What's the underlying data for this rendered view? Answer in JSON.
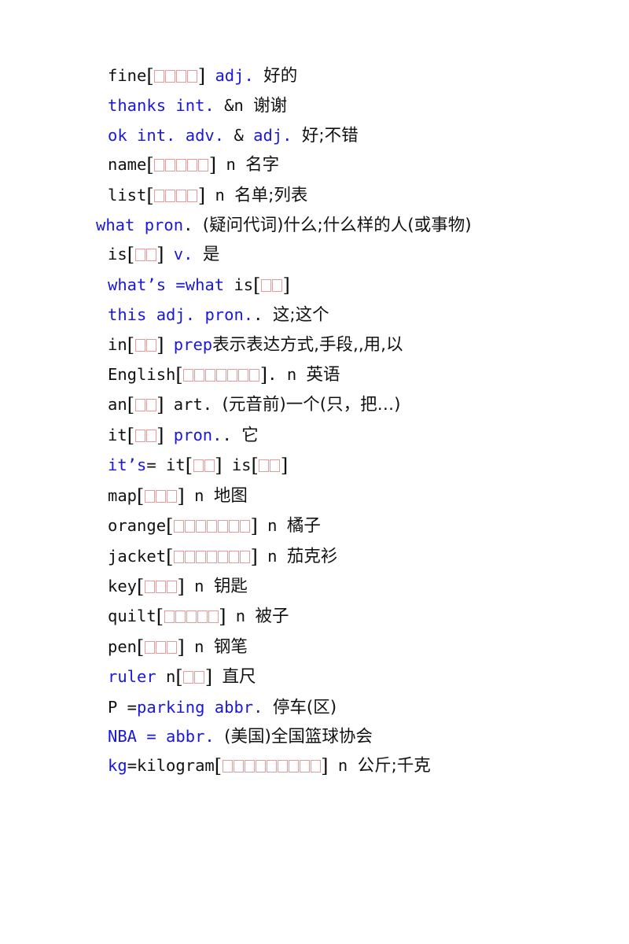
{
  "document": {
    "type": "vocabulary-word-list",
    "language_pair": "English-Chinese",
    "text_colors": {
      "accent_blue": "#1a18d8",
      "body_black": "#111111",
      "tofu_box_outline": "#e89a9a"
    },
    "note": "Phonetic transcriptions render as missing-glyph boxes (tofu)"
  },
  "entries": [
    {
      "id": "fine",
      "indent": "normal",
      "parts": [
        {
          "text": "fine",
          "color": "black",
          "script": "latin"
        },
        {
          "type": "phonetic",
          "boxes": 4
        },
        {
          "text": " ",
          "color": "black",
          "script": "latin"
        },
        {
          "text": "adj.",
          "color": "blue",
          "script": "latin"
        },
        {
          "text": " ",
          "color": "black",
          "script": "latin"
        },
        {
          "text": "好的",
          "color": "black",
          "script": "han"
        }
      ]
    },
    {
      "id": "thanks",
      "indent": "normal",
      "parts": [
        {
          "text": "thanks int.",
          "color": "blue",
          "script": "latin"
        },
        {
          "text": " &n ",
          "color": "black",
          "script": "latin"
        },
        {
          "text": "谢谢",
          "color": "black",
          "script": "han"
        }
      ]
    },
    {
      "id": "ok",
      "indent": "normal",
      "parts": [
        {
          "text": "ok int. adv.",
          "color": "blue",
          "script": "latin"
        },
        {
          "text": " & ",
          "color": "black",
          "script": "latin"
        },
        {
          "text": "adj.",
          "color": "blue",
          "script": "latin"
        },
        {
          "text": " ",
          "color": "black",
          "script": "latin"
        },
        {
          "text": "好;不错",
          "color": "black",
          "script": "han"
        }
      ]
    },
    {
      "id": "name",
      "indent": "normal",
      "parts": [
        {
          "text": "name",
          "color": "black",
          "script": "latin"
        },
        {
          "type": "phonetic",
          "boxes": 5
        },
        {
          "text": " n ",
          "color": "black",
          "script": "latin"
        },
        {
          "text": "名字",
          "color": "black",
          "script": "han"
        }
      ]
    },
    {
      "id": "list",
      "indent": "normal",
      "parts": [
        {
          "text": "list",
          "color": "black",
          "script": "latin"
        },
        {
          "type": "phonetic",
          "boxes": 4
        },
        {
          "text": " n ",
          "color": "black",
          "script": "latin"
        },
        {
          "text": "名单;列表",
          "color": "black",
          "script": "han"
        }
      ]
    },
    {
      "id": "what",
      "indent": "small",
      "parts": [
        {
          "text": "what pron",
          "color": "blue",
          "script": "latin"
        },
        {
          "text": ". ",
          "color": "black",
          "script": "latin"
        },
        {
          "text": "(疑问代词)什么;什么样的人(或事物)",
          "color": "black",
          "script": "han",
          "wrapable": true
        }
      ]
    },
    {
      "id": "is",
      "indent": "normal",
      "parts": [
        {
          "text": "is",
          "color": "black",
          "script": "latin"
        },
        {
          "type": "phonetic",
          "boxes": 2
        },
        {
          "text": " ",
          "color": "black",
          "script": "latin"
        },
        {
          "text": "v.",
          "color": "blue",
          "script": "latin"
        },
        {
          "text": " ",
          "color": "black",
          "script": "latin"
        },
        {
          "text": "是",
          "color": "black",
          "script": "han"
        }
      ]
    },
    {
      "id": "whats",
      "indent": "normal",
      "parts": [
        {
          "text": "what’s =what",
          "color": "blue",
          "script": "latin"
        },
        {
          "text": " is",
          "color": "black",
          "script": "latin"
        },
        {
          "type": "phonetic",
          "boxes": 2
        }
      ]
    },
    {
      "id": "this",
      "indent": "normal",
      "parts": [
        {
          "text": "this adj.",
          "color": "blue",
          "script": "latin"
        },
        {
          "text": " ",
          "color": "black",
          "script": "latin"
        },
        {
          "text": "pron.",
          "color": "blue",
          "script": "latin"
        },
        {
          "text": ". ",
          "color": "black",
          "script": "latin"
        },
        {
          "text": "这;这个",
          "color": "black",
          "script": "han"
        }
      ]
    },
    {
      "id": "in",
      "indent": "normal",
      "parts": [
        {
          "text": "in",
          "color": "black",
          "script": "latin"
        },
        {
          "type": "phonetic",
          "boxes": 2
        },
        {
          "text": " ",
          "color": "black",
          "script": "latin"
        },
        {
          "text": "prep",
          "color": "blue",
          "script": "latin"
        },
        {
          "text": "表示表达方式,手段,,用,以",
          "color": "black",
          "script": "han"
        }
      ]
    },
    {
      "id": "english",
      "indent": "normal",
      "parts": [
        {
          "text": "English",
          "color": "black",
          "script": "latin"
        },
        {
          "type": "phonetic",
          "boxes": 7
        },
        {
          "text": ". n ",
          "color": "black",
          "script": "latin"
        },
        {
          "text": "英语",
          "color": "black",
          "script": "han"
        }
      ]
    },
    {
      "id": "an",
      "indent": "normal",
      "parts": [
        {
          "text": "an",
          "color": "black",
          "script": "latin"
        },
        {
          "type": "phonetic",
          "boxes": 2
        },
        {
          "text": " art. ",
          "color": "black",
          "script": "latin"
        },
        {
          "text": "(元音前)一个(只，把…)",
          "color": "black",
          "script": "han"
        }
      ]
    },
    {
      "id": "it",
      "indent": "normal",
      "parts": [
        {
          "text": "it",
          "color": "black",
          "script": "latin"
        },
        {
          "type": "phonetic",
          "boxes": 2
        },
        {
          "text": " ",
          "color": "black",
          "script": "latin"
        },
        {
          "text": "pron.",
          "color": "blue",
          "script": "latin"
        },
        {
          "text": ". ",
          "color": "black",
          "script": "latin"
        },
        {
          "text": "它",
          "color": "black",
          "script": "han"
        }
      ]
    },
    {
      "id": "its",
      "indent": "normal",
      "parts": [
        {
          "text": "it’s",
          "color": "blue",
          "script": "latin"
        },
        {
          "text": "= it",
          "color": "black",
          "script": "latin"
        },
        {
          "type": "phonetic",
          "boxes": 2
        },
        {
          "text": " is",
          "color": "black",
          "script": "latin"
        },
        {
          "type": "phonetic",
          "boxes": 2
        }
      ]
    },
    {
      "id": "map",
      "indent": "normal",
      "parts": [
        {
          "text": "map",
          "color": "black",
          "script": "latin"
        },
        {
          "type": "phonetic",
          "boxes": 3
        },
        {
          "text": " n ",
          "color": "black",
          "script": "latin"
        },
        {
          "text": "地图",
          "color": "black",
          "script": "han"
        }
      ]
    },
    {
      "id": "orange",
      "indent": "normal",
      "parts": [
        {
          "text": "orange",
          "color": "black",
          "script": "latin"
        },
        {
          "type": "phonetic",
          "boxes": 7
        },
        {
          "text": " n ",
          "color": "black",
          "script": "latin"
        },
        {
          "text": "橘子",
          "color": "black",
          "script": "han"
        }
      ]
    },
    {
      "id": "jacket",
      "indent": "normal",
      "parts": [
        {
          "text": "jacket",
          "color": "black",
          "script": "latin"
        },
        {
          "type": "phonetic",
          "boxes": 7
        },
        {
          "text": " n ",
          "color": "black",
          "script": "latin"
        },
        {
          "text": "茄克衫",
          "color": "black",
          "script": "han"
        }
      ]
    },
    {
      "id": "key",
      "indent": "normal",
      "parts": [
        {
          "text": "key",
          "color": "black",
          "script": "latin"
        },
        {
          "type": "phonetic",
          "boxes": 3
        },
        {
          "text": " n ",
          "color": "black",
          "script": "latin"
        },
        {
          "text": "钥匙",
          "color": "black",
          "script": "han"
        }
      ]
    },
    {
      "id": "quilt",
      "indent": "normal",
      "parts": [
        {
          "text": "quilt",
          "color": "black",
          "script": "latin"
        },
        {
          "type": "phonetic",
          "boxes": 5
        },
        {
          "text": " n ",
          "color": "black",
          "script": "latin"
        },
        {
          "text": "被子",
          "color": "black",
          "script": "han"
        }
      ]
    },
    {
      "id": "pen",
      "indent": "normal",
      "parts": [
        {
          "text": "pen",
          "color": "black",
          "script": "latin"
        },
        {
          "type": "phonetic",
          "boxes": 3
        },
        {
          "text": " n ",
          "color": "black",
          "script": "latin"
        },
        {
          "text": "钢笔",
          "color": "black",
          "script": "han"
        }
      ]
    },
    {
      "id": "ruler",
      "indent": "normal",
      "parts": [
        {
          "text": "ruler",
          "color": "blue",
          "script": "latin"
        },
        {
          "text": " n",
          "color": "black",
          "script": "latin"
        },
        {
          "type": "phonetic",
          "boxes": 2
        },
        {
          "text": " ",
          "color": "black",
          "script": "latin"
        },
        {
          "text": "直尺",
          "color": "black",
          "script": "han"
        }
      ]
    },
    {
      "id": "parking",
      "indent": "normal",
      "parts": [
        {
          "text": "P =",
          "color": "black",
          "script": "latin"
        },
        {
          "text": "parking abbr.",
          "color": "blue",
          "script": "latin"
        },
        {
          "text": " ",
          "color": "black",
          "script": "latin"
        },
        {
          "text": "停车(区)",
          "color": "black",
          "script": "han"
        }
      ]
    },
    {
      "id": "nba",
      "indent": "normal",
      "parts": [
        {
          "text": "NBA = abbr.",
          "color": "blue",
          "script": "latin"
        },
        {
          "text": " ",
          "color": "black",
          "script": "latin"
        },
        {
          "text": "(美国)全国篮球协会",
          "color": "black",
          "script": "han"
        }
      ]
    },
    {
      "id": "kilogram",
      "indent": "normal",
      "parts": [
        {
          "text": "kg",
          "color": "blue",
          "script": "latin"
        },
        {
          "text": "=kilogram",
          "color": "black",
          "script": "latin"
        },
        {
          "type": "phonetic",
          "boxes": 9
        },
        {
          "text": " n ",
          "color": "black",
          "script": "latin"
        },
        {
          "text": "公斤;千克",
          "color": "black",
          "script": "han",
          "wrapable": true
        }
      ]
    }
  ]
}
